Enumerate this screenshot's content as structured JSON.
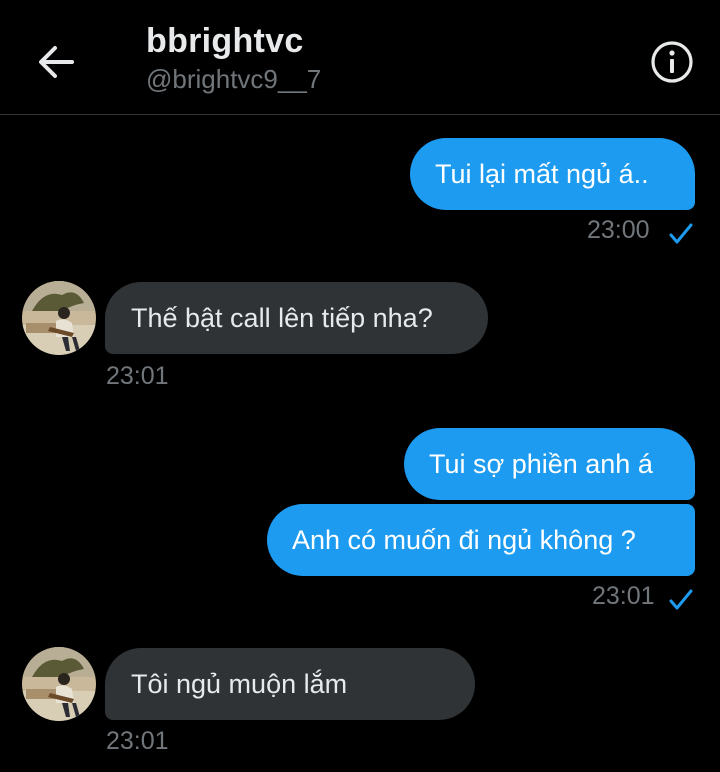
{
  "header": {
    "title": "bbrightvc",
    "handle": "@brightvc9__7"
  },
  "colors": {
    "background": "#000000",
    "outgoing_bubble": "#1d9bf0",
    "incoming_bubble": "#2f3336",
    "timestamp": "#71767b",
    "read_check": "#1d9bf0"
  },
  "icons": {
    "back": "back-arrow-icon",
    "info": "info-icon",
    "read": "checkmark-icon"
  },
  "messages": [
    {
      "direction": "out",
      "text": "Tui lại mất ngủ á.."
    },
    {
      "direction": "out",
      "time": "23:00"
    },
    {
      "direction": "in",
      "text": "Thế bật call lên tiếp nha?"
    },
    {
      "direction": "in",
      "time": "23:01"
    },
    {
      "direction": "out",
      "text": "Tui sợ phiền anh á"
    },
    {
      "direction": "out",
      "text": "Anh có muốn đi ngủ không ?"
    },
    {
      "direction": "out",
      "time": "23:01"
    },
    {
      "direction": "in",
      "text": "Tôi ngủ muộn lắm"
    },
    {
      "direction": "in",
      "time": "23:01"
    }
  ]
}
